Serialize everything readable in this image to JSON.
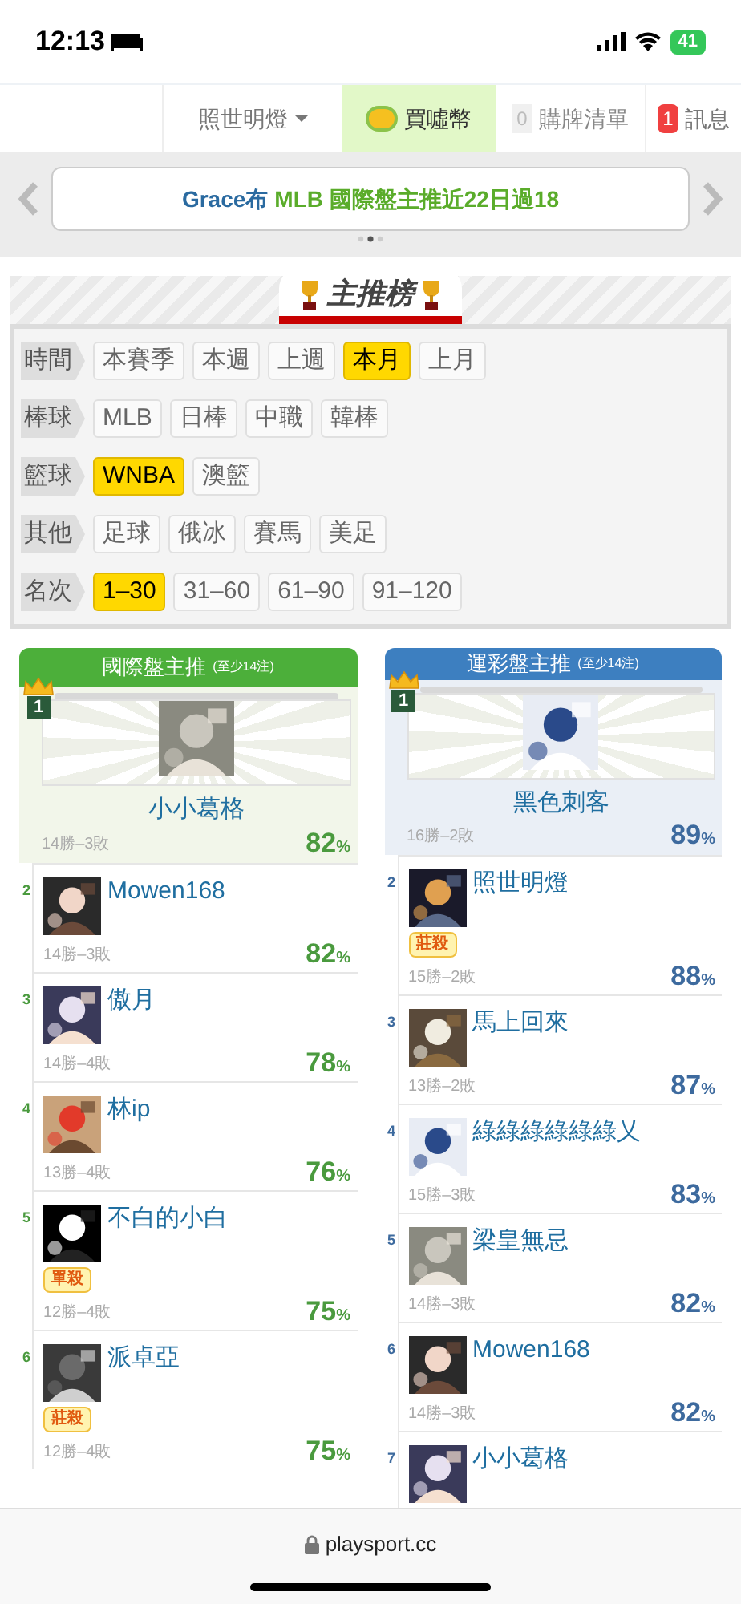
{
  "status_bar": {
    "time": "12:13",
    "battery": "41"
  },
  "nav": {
    "user": "照世明燈",
    "coins": "買噓幣",
    "cart_count": "0",
    "cart": "購牌清單",
    "msg_count": "1",
    "messages": "訊息"
  },
  "banner": {
    "author": "Grace布",
    "headline": "MLB 國際盤主推近22日過18"
  },
  "ranking_title": "主推榜",
  "filters": [
    {
      "label": "時間",
      "options": [
        {
          "text": "本賽季",
          "selected": false
        },
        {
          "text": "本週",
          "selected": false
        },
        {
          "text": "上週",
          "selected": false
        },
        {
          "text": "本月",
          "selected": true
        },
        {
          "text": "上月",
          "selected": false
        }
      ]
    },
    {
      "label": "棒球",
      "options": [
        {
          "text": "MLB",
          "selected": false
        },
        {
          "text": "日棒",
          "selected": false
        },
        {
          "text": "中職",
          "selected": false
        },
        {
          "text": "韓棒",
          "selected": false
        }
      ]
    },
    {
      "label": "籃球",
      "options": [
        {
          "text": "WNBA",
          "selected": true
        },
        {
          "text": "澳籃",
          "selected": false
        }
      ]
    },
    {
      "label": "其他",
      "options": [
        {
          "text": "足球",
          "selected": false
        },
        {
          "text": "俄冰",
          "selected": false
        },
        {
          "text": "賽馬",
          "selected": false
        },
        {
          "text": "美足",
          "selected": false
        }
      ]
    },
    {
      "label": "名次",
      "options": [
        {
          "text": "1–30",
          "selected": true
        },
        {
          "text": "31–60",
          "selected": false
        },
        {
          "text": "61–90",
          "selected": false
        },
        {
          "text": "91–120",
          "selected": false
        }
      ]
    }
  ],
  "columns": [
    {
      "title": "國際盤主推",
      "note": "(至少14注)",
      "color": "#4caf3a",
      "rows": [
        {
          "rank": "1",
          "name": "小小葛格",
          "record": "14勝–3敗",
          "pct": "82%"
        },
        {
          "rank": "2",
          "name": "Mowen168",
          "record": "14勝–3敗",
          "pct": "82%"
        },
        {
          "rank": "3",
          "name": "傲月",
          "record": "14勝–4敗",
          "pct": "78%"
        },
        {
          "rank": "4",
          "name": "林ip",
          "record": "13勝–4敗",
          "pct": "76%"
        },
        {
          "rank": "5",
          "name": "不白的小白",
          "tag": "單殺",
          "record": "12勝–4敗",
          "pct": "75%"
        },
        {
          "rank": "6",
          "name": "派卓亞",
          "tag": "莊殺",
          "record": "12勝–4敗",
          "pct": "75%"
        }
      ]
    },
    {
      "title": "運彩盤主推",
      "note": "(至少14注)",
      "color": "#3d7fc0",
      "rows": [
        {
          "rank": "1",
          "name": "黑色刺客",
          "record": "16勝–2敗",
          "pct": "89%"
        },
        {
          "rank": "2",
          "name": "照世明燈",
          "tag": "莊殺",
          "record": "15勝–2敗",
          "pct": "88%"
        },
        {
          "rank": "3",
          "name": "馬上回來",
          "record": "13勝–2敗",
          "pct": "87%"
        },
        {
          "rank": "4",
          "name": "綠綠綠綠綠綠乂",
          "record": "15勝–3敗",
          "pct": "83%"
        },
        {
          "rank": "5",
          "name": "梁皇無忌",
          "record": "14勝–3敗",
          "pct": "82%"
        },
        {
          "rank": "6",
          "name": "Mowen168",
          "record": "14勝–3敗",
          "pct": "82%"
        },
        {
          "rank": "7",
          "name": "小小葛格"
        }
      ]
    }
  ],
  "browser": {
    "url": "playsport.cc"
  }
}
